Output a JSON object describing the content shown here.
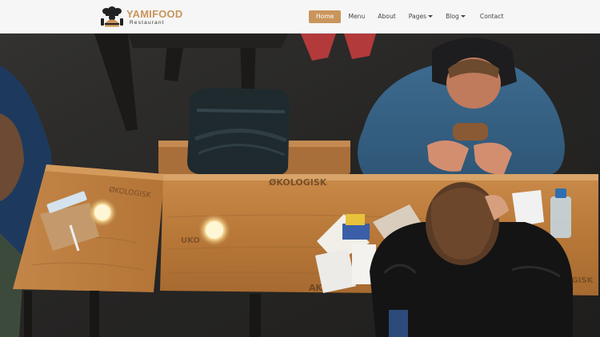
{
  "brand": {
    "name": "YAMIFOOD",
    "tagline": "Restaurant",
    "logo_icon": "chef-burger-logo-icon"
  },
  "nav": {
    "items": [
      {
        "label": "Home",
        "active": true,
        "dropdown": false
      },
      {
        "label": "Menu",
        "active": false,
        "dropdown": false
      },
      {
        "label": "About",
        "active": false,
        "dropdown": false
      },
      {
        "label": "Pages",
        "active": false,
        "dropdown": true
      },
      {
        "label": "Blog",
        "active": false,
        "dropdown": true
      },
      {
        "label": "Contact",
        "active": false,
        "dropdown": false
      }
    ]
  },
  "hero": {
    "image": "people-eating-at-wooden-table-photo",
    "table_stamps": [
      "ØKOLOGISK",
      "ØKOLOGISK",
      "AKN",
      "UKO"
    ]
  },
  "colors": {
    "accent": "#c9955b",
    "navbar_bg": "#f6f6f6",
    "nav_text": "#444444"
  }
}
